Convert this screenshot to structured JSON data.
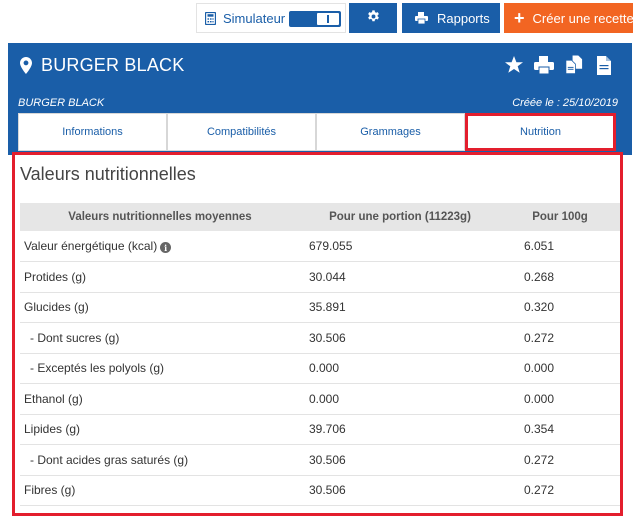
{
  "toolbar": {
    "simulator_label": "Simulateur",
    "reports_label": "Rapports",
    "create_label": "Créer une recette",
    "colors": {
      "primary": "#1a5ea8",
      "create": "#f26522"
    }
  },
  "recipe": {
    "title": "BURGER BLACK",
    "subtitle": "BURGER BLACK",
    "created": "Créée le : 25/10/2019",
    "header_icons": [
      "star-icon",
      "print-icon",
      "copy-files-icon",
      "document-icon"
    ]
  },
  "tabs": [
    {
      "label": "Informations"
    },
    {
      "label": "Compatibilités"
    },
    {
      "label": "Grammages"
    },
    {
      "label": "Nutrition",
      "active": true
    }
  ],
  "nutrition": {
    "title": "Valeurs nutritionnelles",
    "headers": {
      "name": "Valeurs nutritionnelles moyennes",
      "portion": "Pour une portion  (11223g)",
      "per100": "Pour 100g"
    },
    "rows": [
      {
        "label": "Valeur énergétique (kcal)",
        "portion": "679.055",
        "per100": "6.051",
        "info": true
      },
      {
        "label": "Protides (g)",
        "portion": "30.044",
        "per100": "0.268"
      },
      {
        "label": "Glucides (g)",
        "portion": "35.891",
        "per100": "0.320"
      },
      {
        "label": "- Dont sucres (g)",
        "portion": "30.506",
        "per100": "0.272",
        "sub": true
      },
      {
        "label": "- Exceptés les polyols (g)",
        "portion": "0.000",
        "per100": "0.000",
        "sub": true
      },
      {
        "label": "Ethanol (g)",
        "portion": "0.000",
        "per100": "0.000"
      },
      {
        "label": "Lipides (g)",
        "portion": "39.706",
        "per100": "0.354"
      },
      {
        "label": "- Dont acides gras saturés (g)",
        "portion": "30.506",
        "per100": "0.272",
        "sub": true
      },
      {
        "label": "Fibres (g)",
        "portion": "30.506",
        "per100": "0.272"
      }
    ],
    "highlight_color": "#e31e2d"
  }
}
